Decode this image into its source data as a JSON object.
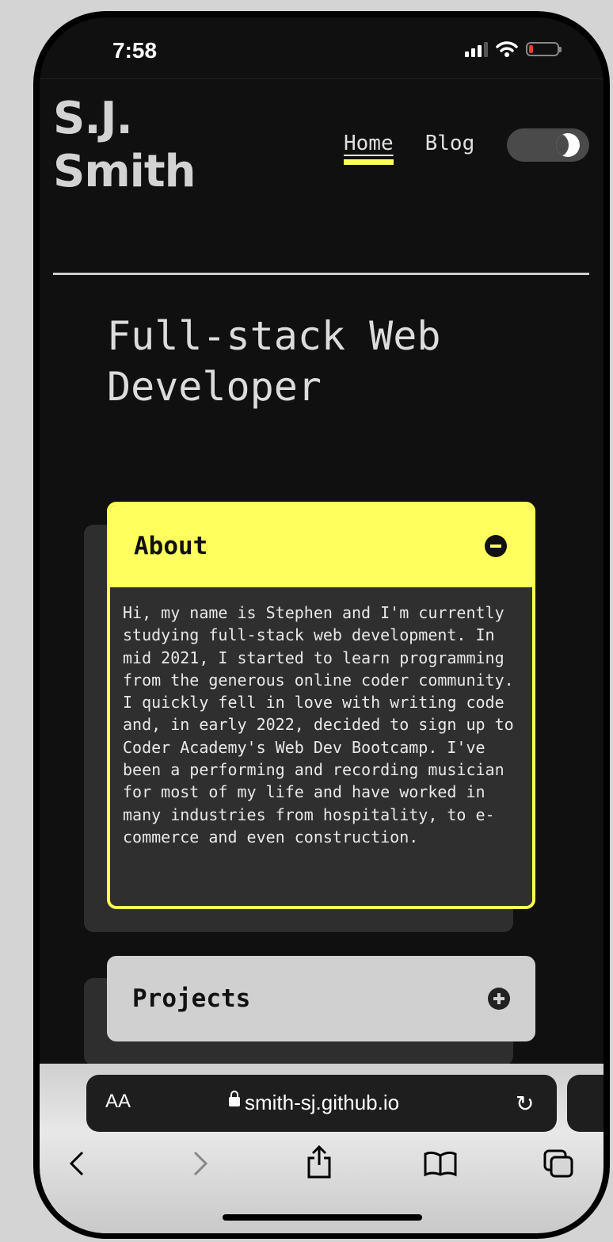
{
  "status_bar": {
    "time": "7:58"
  },
  "header": {
    "logo_line1": "S.J.",
    "logo_line2": "Smith",
    "nav": [
      {
        "label": "Home",
        "active": true
      },
      {
        "label": "Blog",
        "active": false
      }
    ],
    "theme_toggle_icon": "moon-icon"
  },
  "hero": {
    "title": "Full-stack Web Developer"
  },
  "about": {
    "title": "About",
    "icon": "minus-circle-icon",
    "body": "Hi, my name is Stephen and I'm currently studying full-stack web development. In mid 2021, I started to learn programming from the generous online coder community. I quickly fell in love with writing code and, in early 2022, decided to sign up to Coder Academy's Web Dev Bootcamp. I've been a performing and recording musician for most of my life and have worked in many industries from hospitality, to e-commerce and even construction."
  },
  "projects": {
    "title": "Projects",
    "icon": "plus-circle-icon"
  },
  "browser": {
    "aa_label": "AA",
    "url": "smith-sj.github.io",
    "toolbar_icons": [
      "back-icon",
      "forward-icon",
      "share-icon",
      "bookmarks-icon",
      "tabs-icon"
    ]
  },
  "colors": {
    "accent": "#ffff55",
    "background": "#101010",
    "card": "#2f2f2f"
  }
}
